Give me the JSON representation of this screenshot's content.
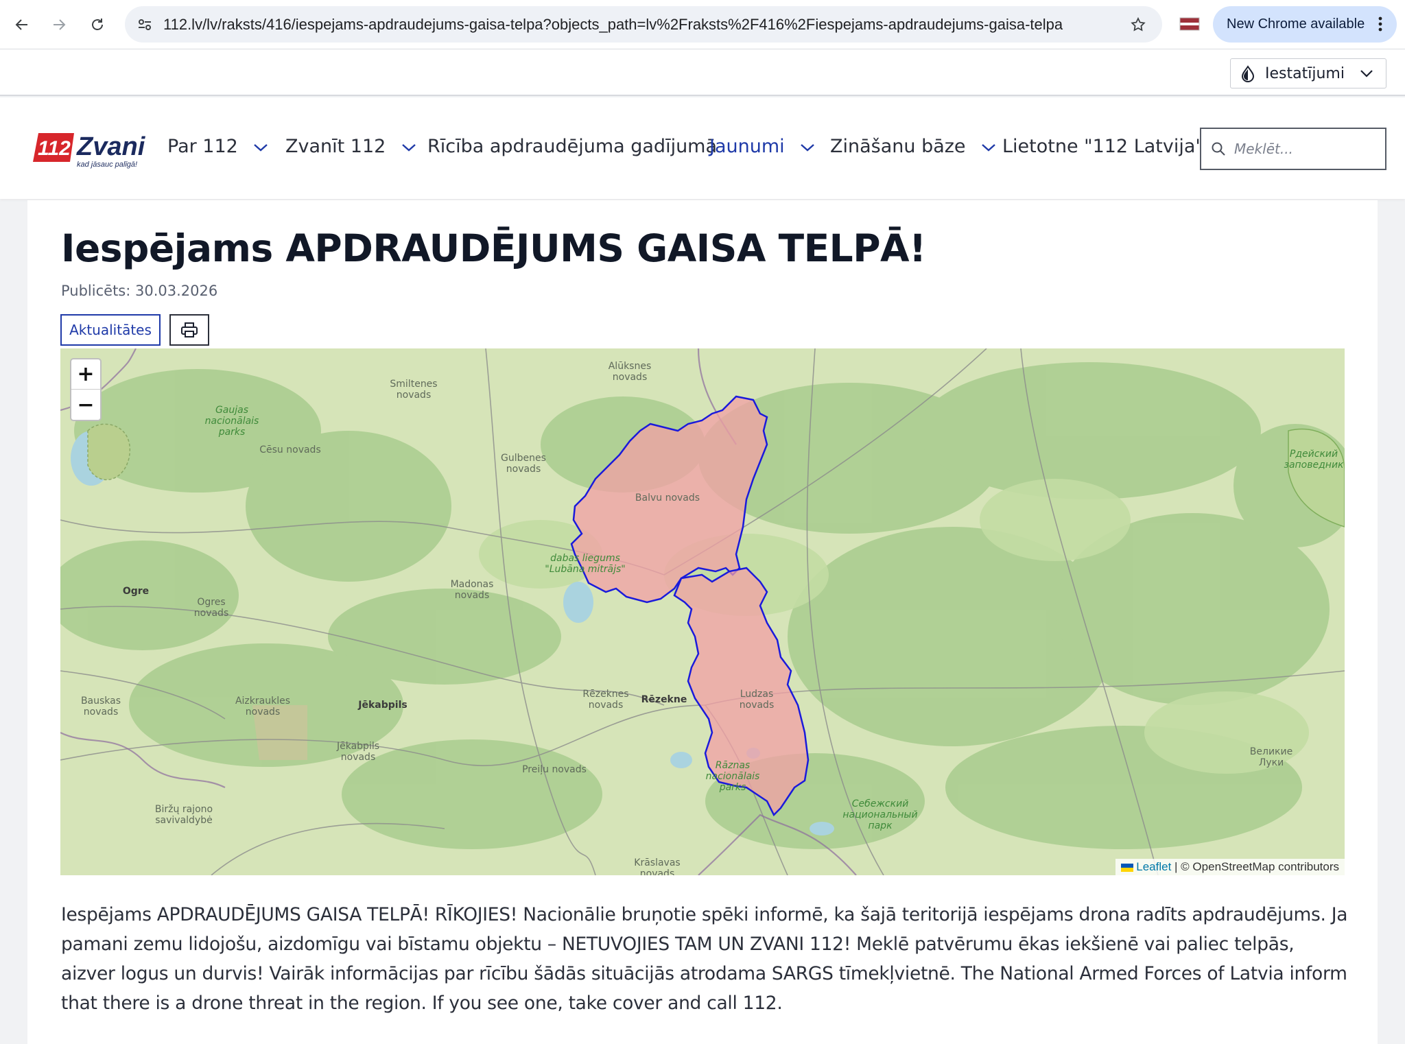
{
  "browser": {
    "url": "112.lv/lv/raksts/416/iespejams-apdraudejums-gaisa-telpa?objects_path=lv%2Fraksts%2F416%2Fiespejams-apdraudejums-gaisa-telpa",
    "update_label": "New Chrome available"
  },
  "settings": {
    "label": "Iestatījumi"
  },
  "header": {
    "logo_text": "Zvani",
    "logo_number": "112",
    "logo_tagline": "kad jāsauc palīgā!",
    "nav": [
      {
        "label": "Par 112"
      },
      {
        "label": "Zvanīt 112"
      },
      {
        "label": "Rīcība apdraudējuma gadījumā"
      },
      {
        "label": "Jaunumi"
      },
      {
        "label": "Zināšanu bāze"
      },
      {
        "label": "Lietotne \"112 Latvija\""
      }
    ],
    "search_placeholder": "Meklēt..."
  },
  "article": {
    "title": "Iespējams APDRAUDĒJUMS GAISA TELPĀ!",
    "published": "Publicēts: 30.03.2026",
    "tag": "Aktualitātes",
    "body": "Iespējams APDRAUDĒJUMS GAISA TELPĀ! RĪKOJIES! Nacionālie bruņotie spēki informē, ka šajā teritorijā iespējams drona radīts apdraudējums. Ja pamani zemu lidojošu, aizdomīgu vai bīstamu objektu – NETUVOJIES TAM UN ZVANI 112! Meklē patvērumu ēkas iekšienē vai paliec telpās, aizver logus un durvis! Vairāk informācijas par rīcību šādās situācijās atrodama SARGS tīmekļvietnē. The National Armed Forces of Latvia inform that there is a drone threat in the region. If you see one, take cover and call 112."
  },
  "map": {
    "zoom_in": "+",
    "zoom_out": "−",
    "attribution_link": "Leaflet",
    "attribution_text": "| © OpenStreetMap contributors",
    "highlight_fill": "#f2a0a6",
    "highlight_stroke": "#1a1adb",
    "labels": [
      {
        "text": "Alūksnes novads"
      },
      {
        "text": "Smiltenes novads"
      },
      {
        "text": "Gaujas nacionālais parks"
      },
      {
        "text": "Cēsu novads"
      },
      {
        "text": "Gulbenes novads"
      },
      {
        "text": "Balvu novads"
      },
      {
        "text": "dabas liegums \"Lubāna mitrājs\""
      },
      {
        "text": "Madonas novads"
      },
      {
        "text": "Ogre"
      },
      {
        "text": "Ogres novads"
      },
      {
        "text": "Rēzeknes novads"
      },
      {
        "text": "Rēzekne"
      },
      {
        "text": "Ludzas novads"
      },
      {
        "text": "Bauskas novads"
      },
      {
        "text": "Aizkraukles novads"
      },
      {
        "text": "Jēkabpils"
      },
      {
        "text": "Jēkabpils novads"
      },
      {
        "text": "Preiļu novads"
      },
      {
        "text": "Rāznas nacionālais parks"
      },
      {
        "text": "Biržų rajono savivaldybė"
      },
      {
        "text": "Krāslavas novads"
      },
      {
        "text": "Себежский национальный парк"
      },
      {
        "text": "Великие Луки"
      },
      {
        "text": "Рдейский заповедник"
      }
    ]
  }
}
